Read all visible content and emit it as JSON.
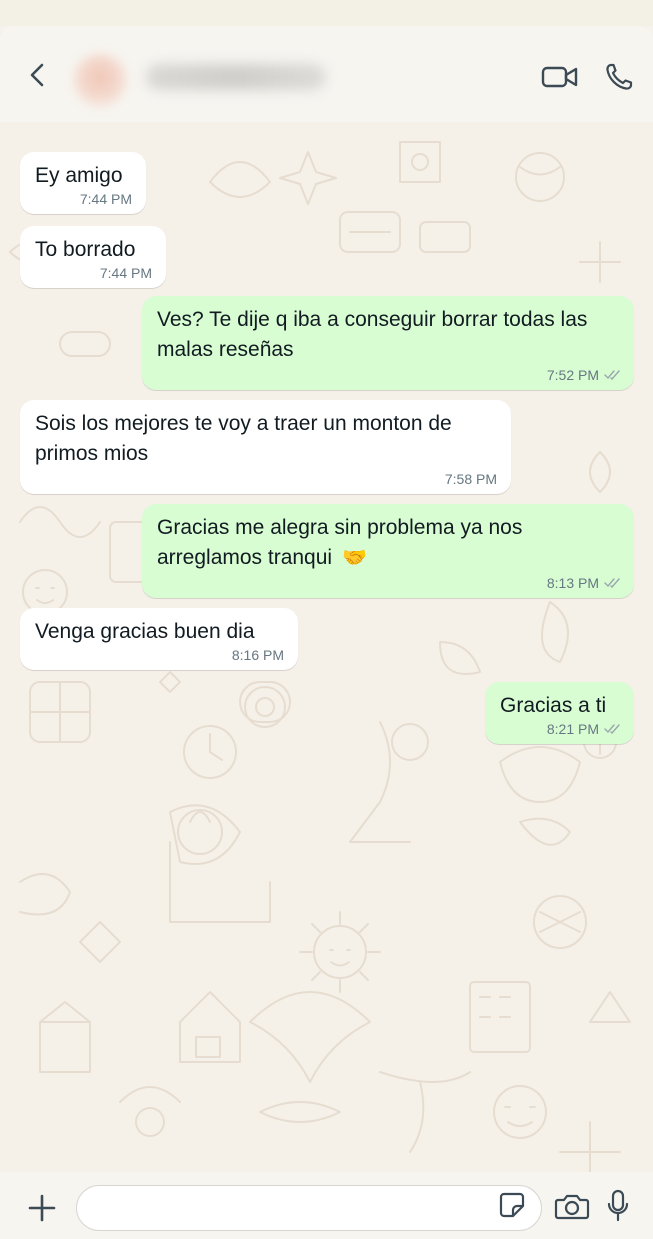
{
  "header": {
    "back_icon": "chevron-left-icon",
    "contact_name": "",
    "video_icon": "video-camera-icon",
    "call_icon": "phone-icon"
  },
  "messages": [
    {
      "direction": "incoming",
      "text": "Ey amigo",
      "time": "7:44 PM"
    },
    {
      "direction": "incoming",
      "text": "To borrado",
      "time": "7:44 PM"
    },
    {
      "direction": "outgoing",
      "text": "Ves? Te dije q iba a conseguir borrar todas las malas reseñas",
      "time": "7:52 PM",
      "status": "read-double-check"
    },
    {
      "direction": "incoming",
      "text": "Sois los mejores te voy a traer un monton de primos mios",
      "time": "7:58 PM"
    },
    {
      "direction": "outgoing",
      "text": "Gracias me alegra sin problema ya nos arreglamos tranqui",
      "emoji": "🤝",
      "time": "8:13 PM",
      "status": "read-double-check"
    },
    {
      "direction": "incoming",
      "text": "Venga gracias buen dia",
      "time": "8:16 PM"
    },
    {
      "direction": "outgoing",
      "text": "Gracias a ti",
      "time": "8:21 PM",
      "status": "read-double-check"
    }
  ],
  "composer": {
    "plus_icon": "plus-icon",
    "input_value": "",
    "input_placeholder": "",
    "sticker_icon": "sticker-icon",
    "camera_icon": "camera-icon",
    "mic_icon": "microphone-icon"
  },
  "colors": {
    "incoming_bubble": "#ffffff",
    "outgoing_bubble": "#d9fdd3",
    "chat_background": "#f5f1e9",
    "timestamp": "#667781",
    "text": "#111b21"
  }
}
